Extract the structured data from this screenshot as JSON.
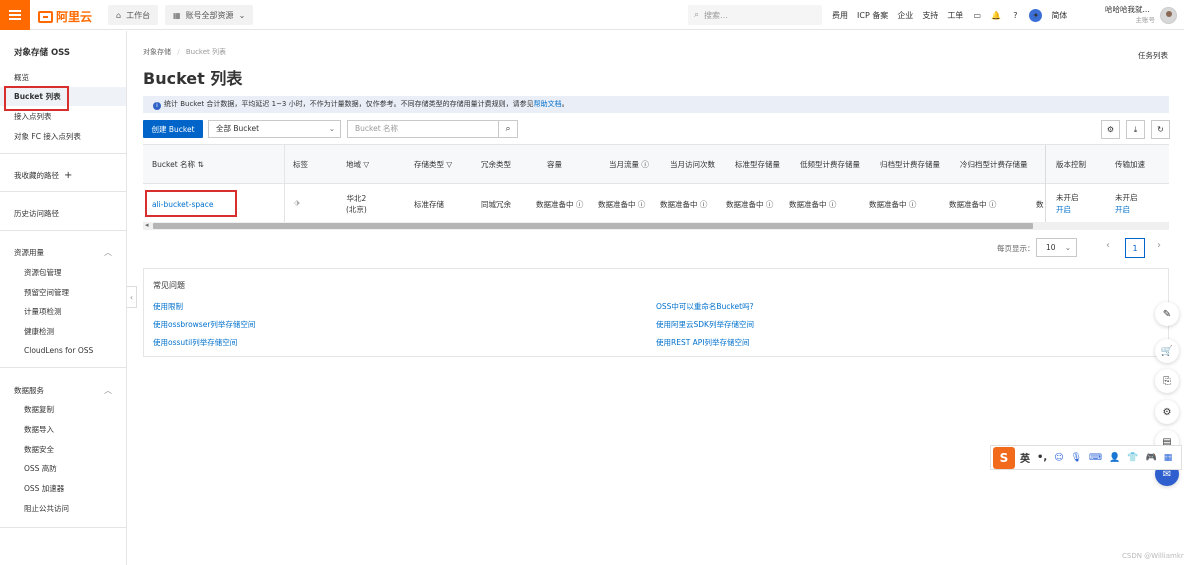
{
  "topbar": {
    "brand": "阿里云",
    "workbench": "工作台",
    "account_scope": "账号全部资源",
    "search_placeholder": "搜索...",
    "links": [
      "费用",
      "ICP 备案",
      "企业",
      "支持",
      "工单"
    ],
    "lang": "简体",
    "user_name": "哈哈哈我就...",
    "user_type": "主账号"
  },
  "sidebar": {
    "title": "对象存储 OSS",
    "items": [
      "概览",
      "Bucket 列表",
      "接入点列表",
      "对象 FC 接入点列表"
    ],
    "favorites": "我收藏的路径",
    "history": "历史访问路径",
    "resource_group": {
      "label": "资源用量",
      "items": [
        "资源包管理",
        "预留空间管理",
        "计量项检测",
        "健康检测",
        "CloudLens for OSS"
      ]
    },
    "data_group": {
      "label": "数据服务",
      "items": [
        "数据复制",
        "数据导入",
        "数据安全",
        "OSS 高防",
        "OSS 加速器",
        "阻止公共访问"
      ]
    }
  },
  "main": {
    "breadcrumb": [
      "对象存储",
      "Bucket 列表"
    ],
    "task_list": "任务列表",
    "title": "Bucket 列表",
    "notice": "统计 Bucket 合计数据，平均延迟 1~3 小时，不作为计量数据，仅作参考。不同存储类型的存储用量计费规则，请参见",
    "notice_link": "帮助文档",
    "create_button": "创建 Bucket",
    "filter_select": "全部 Bucket",
    "search_placeholder": "Bucket 名称"
  },
  "table": {
    "columns": [
      "Bucket 名称",
      "标签",
      "地域",
      "存储类型",
      "冗余类型",
      "容量",
      "当月流量",
      "当月访问次数",
      "标准型存储量",
      "低频型计费存储量",
      "归档型计费存储量",
      "冷归档型计费存储量",
      "版本控制",
      "传输加速"
    ],
    "rows": [
      {
        "name": "ali-bucket-space",
        "region": "华北2",
        "region_city": "(北京)",
        "storage_type": "标准存储",
        "redundancy": "同城冗余",
        "capacity": "数据准备中",
        "traffic": "数据准备中",
        "visits": "数据准备中",
        "standard": "数据准备中",
        "ia": "数据准备中",
        "archive": "数据准备中",
        "cold_archive": "数据准备中",
        "overflow": "数",
        "versioning": "未开启",
        "versioning_action": "开启",
        "acceleration": "未开启",
        "acceleration_action": "开启"
      }
    ]
  },
  "pagination": {
    "page_size_label": "每页显示：",
    "page_size": "10",
    "current_page": "1"
  },
  "faq": {
    "title": "常见问题",
    "left": [
      "使用限制",
      "使用ossbrowser列举存储空间",
      "使用ossutil列举存储空间"
    ],
    "right": [
      "OSS中可以重命名Bucket吗?",
      "使用阿里云SDK列举存储空间",
      "使用REST API列举存储空间"
    ]
  },
  "ime": {
    "mode": "英"
  },
  "watermark": "CSDN @Williamkr",
  "colors": {
    "brand": "#ff6a00",
    "primary": "#0064c8",
    "highlight": "#d92e2e"
  }
}
